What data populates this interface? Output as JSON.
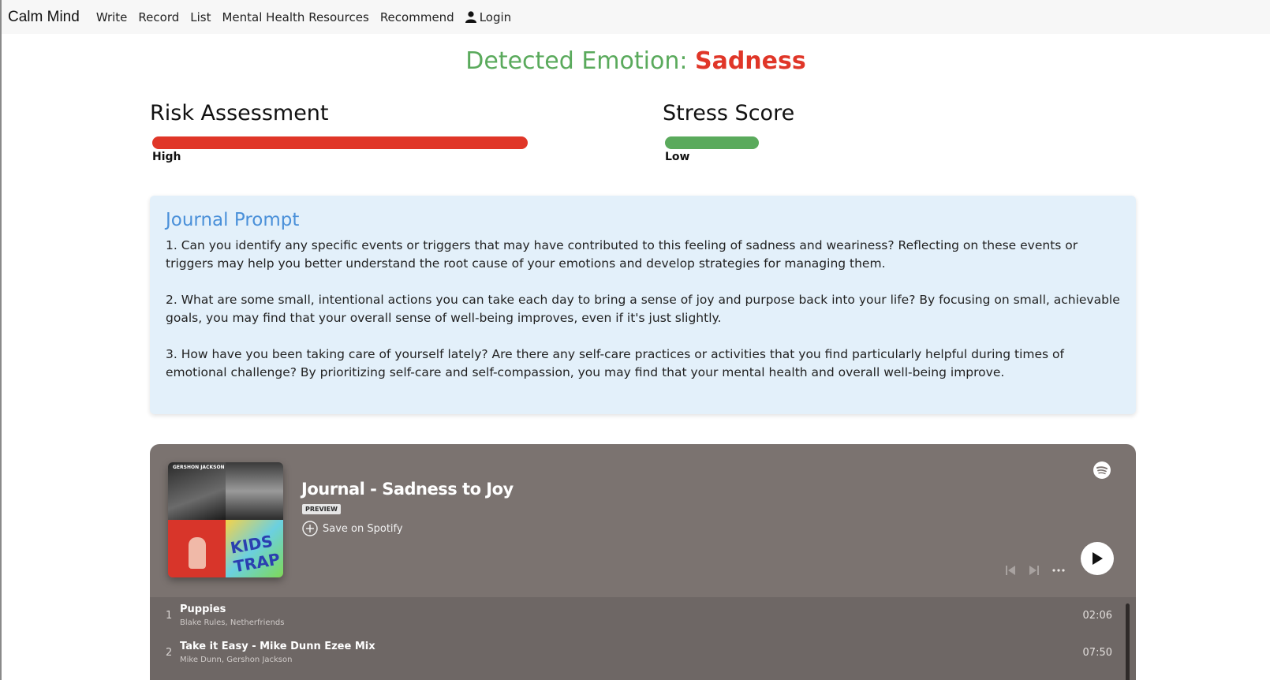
{
  "navbar": {
    "brand": "Calm Mind",
    "links": [
      "Write",
      "Record",
      "List",
      "Mental Health Resources",
      "Recommend"
    ],
    "login": "Login"
  },
  "emotion": {
    "label": "Detected Emotion: ",
    "value": "Sadness"
  },
  "risk": {
    "title": "Risk Assessment",
    "level": "High",
    "fraction": 1.0,
    "color": "#e03628"
  },
  "stress": {
    "title": "Stress Score",
    "level": "Low",
    "fraction": 0.25,
    "color": "#5aaa5c"
  },
  "journal": {
    "title": "Journal Prompt",
    "prompts": [
      "1. Can you identify any specific events or triggers that may have contributed to this feeling of sadness and weariness? Reflecting on these events or triggers may help you better understand the root cause of your emotions and develop strategies for managing them.",
      "2. What are some small, intentional actions you can take each day to bring a sense of joy and purpose back into your life? By focusing on small, achievable goals, you may find that your overall sense of well-being improves, even if it's just slightly.",
      "3. How have you been taking care of yourself lately? Are there any self-care practices or activities that you find particularly helpful during times of emotional challenge? By prioritizing self-care and self-compassion, you may find that your mental health and overall well-being improve."
    ]
  },
  "player": {
    "playlist_title": "Journal - Sadness to Joy",
    "badge": "PREVIEW",
    "save_label": "Save on Spotify",
    "cover_text": "GERSHON JACKSON",
    "cover_text2": "KIDS TRAP 3",
    "tracks": [
      {
        "num": "1",
        "name": "Puppies",
        "artists": "Blake Rules, Netherfriends",
        "duration": "02:06"
      },
      {
        "num": "2",
        "name": "Take it Easy - Mike Dunn Ezee Mix",
        "artists": "Mike Dunn, Gershon Jackson",
        "duration": "07:50"
      }
    ]
  }
}
